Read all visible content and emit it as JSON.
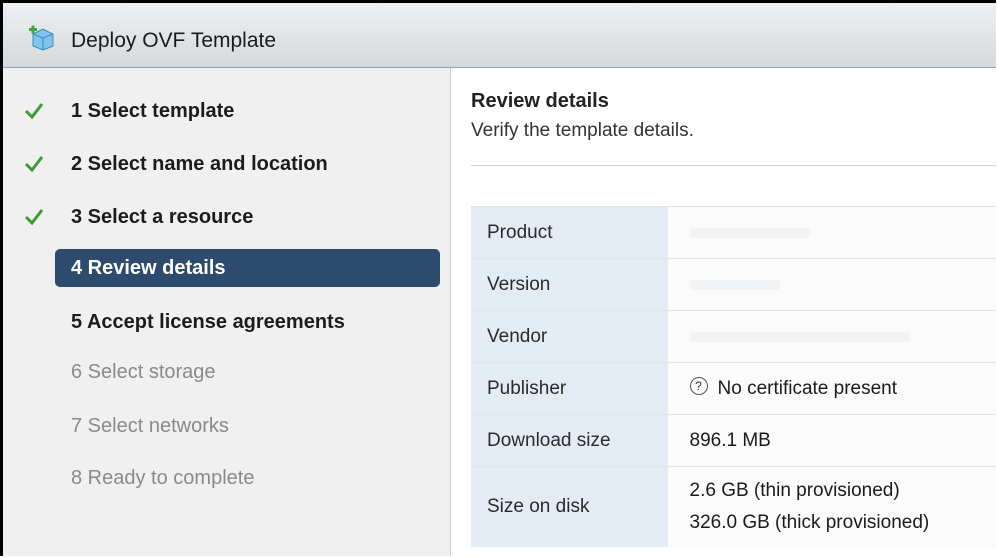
{
  "window": {
    "title": "Deploy OVF Template"
  },
  "steps": [
    {
      "label": "1  Select template",
      "state": "done"
    },
    {
      "label": "2  Select name and location",
      "state": "done"
    },
    {
      "label": "3  Select a resource",
      "state": "done"
    },
    {
      "label": "4  Review details",
      "state": "active"
    },
    {
      "label": "5  Accept license agreements",
      "state": "enabled"
    },
    {
      "label": "6  Select storage",
      "state": "disabled"
    },
    {
      "label": "7  Select networks",
      "state": "disabled"
    },
    {
      "label": "8  Ready to complete",
      "state": "disabled"
    }
  ],
  "content": {
    "heading": "Review details",
    "subheading": "Verify the template details.",
    "details": {
      "product_label": "Product",
      "version_label": "Version",
      "vendor_label": "Vendor",
      "publisher_label": "Publisher",
      "publisher_value": "No certificate present",
      "download_size_label": "Download size",
      "download_size_value": "896.1 MB",
      "size_on_disk_label": "Size on disk",
      "size_on_disk_thin": "2.6 GB (thin provisioned)",
      "size_on_disk_thick": "326.0 GB (thick provisioned)"
    }
  },
  "icons": {
    "app": "vm-template-icon",
    "check": "checkmark-icon",
    "help": "question-circle-icon"
  },
  "colors": {
    "active_step_bg": "#2c4b6d",
    "check_green": "#3c9b32",
    "key_cell_bg": "#e3ecf5"
  }
}
